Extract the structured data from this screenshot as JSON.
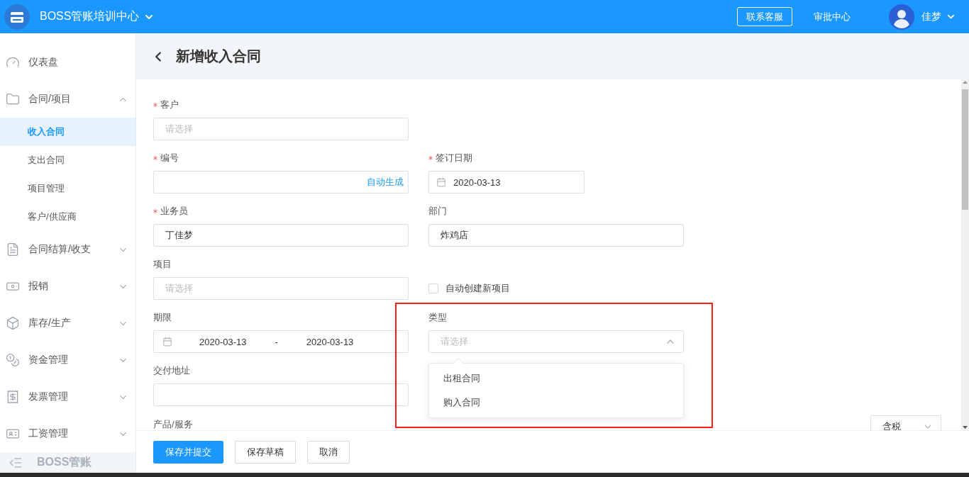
{
  "topbar": {
    "brand": "BOSS管账培训中心",
    "service_button": "联系客服",
    "approval_link": "审批中心",
    "user_name": "佳梦"
  },
  "sidebar": {
    "items": [
      {
        "label": "仪表盘",
        "selected": false
      },
      {
        "label": "合同/项目",
        "selected": false,
        "expanded": true,
        "children": [
          {
            "label": "收入合同",
            "selected": true
          },
          {
            "label": "支出合同",
            "selected": false
          },
          {
            "label": "项目管理",
            "selected": false
          },
          {
            "label": "客户/供应商",
            "selected": false
          }
        ]
      },
      {
        "label": "合同结算/收支",
        "selected": false,
        "expanded": false
      },
      {
        "label": "报销",
        "selected": false,
        "expanded": false
      },
      {
        "label": "库存/生产",
        "selected": false,
        "expanded": false
      },
      {
        "label": "资金管理",
        "selected": false,
        "expanded": false
      },
      {
        "label": "发票管理",
        "selected": false,
        "expanded": false
      },
      {
        "label": "工资管理",
        "selected": false,
        "expanded": false
      }
    ],
    "collapse_label": "BOSS管账"
  },
  "page": {
    "title": "新增收入合同"
  },
  "form": {
    "rows": [
      {
        "fields": [
          {
            "kind": "select",
            "label": "客户",
            "required": true,
            "placeholder": "请选择",
            "expanded": false
          }
        ]
      },
      {
        "fields": [
          {
            "kind": "text",
            "label": "编号",
            "required": true,
            "action": "自动生成"
          },
          {
            "kind": "date",
            "label": "签订日期",
            "required": true,
            "value": "2020-03-13"
          }
        ]
      },
      {
        "fields": [
          {
            "kind": "text",
            "label": "业务员",
            "required": true,
            "value": "丁佳梦"
          },
          {
            "kind": "text",
            "label": "部门",
            "required": false,
            "value": "炸鸡店"
          }
        ]
      },
      {
        "fields": [
          {
            "kind": "select",
            "label": "项目",
            "required": false,
            "placeholder": "请选择",
            "expanded": false
          },
          {
            "kind": "checkbox",
            "label": "自动创建新项目",
            "checked": false
          }
        ]
      },
      {
        "fields": [
          {
            "kind": "daterange",
            "label": "期限",
            "required": false,
            "start": "2020-03-13",
            "separator": "-",
            "end": "2020-03-13"
          },
          {
            "kind": "select",
            "label": "类型",
            "required": false,
            "placeholder": "请选择",
            "expanded": true,
            "options": [
              {
                "label": "出租合同",
                "selected": false
              },
              {
                "label": "购入合同",
                "selected": false
              }
            ]
          }
        ]
      },
      {
        "fields": [
          {
            "kind": "text",
            "label": "交付地址",
            "required": false
          }
        ]
      },
      {
        "fields": [
          {
            "kind": "section",
            "label": "产品/服务",
            "tax_value": "含税"
          }
        ]
      }
    ]
  },
  "footer": {
    "buttons": [
      {
        "label": "保存并提交",
        "kind": "primary"
      },
      {
        "label": "保存草稿",
        "kind": "default"
      },
      {
        "label": "取消",
        "kind": "default"
      }
    ]
  }
}
